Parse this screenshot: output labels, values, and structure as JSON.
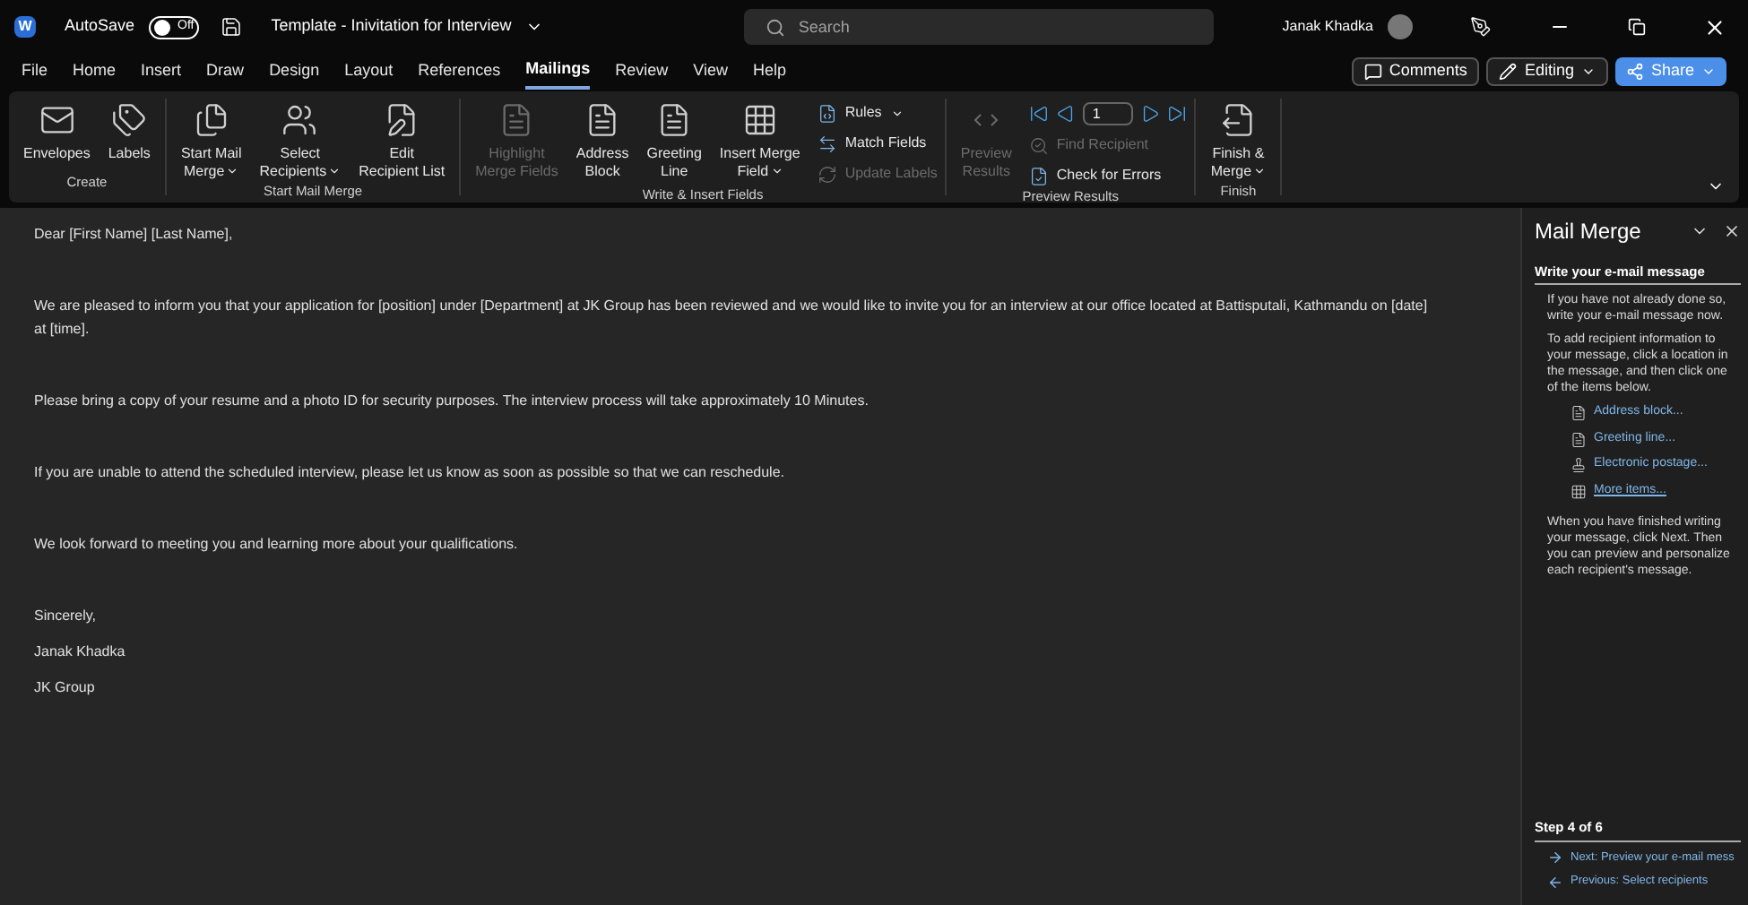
{
  "title_bar": {
    "logo_letter": "W",
    "autosave": {
      "label": "AutoSave",
      "on": false,
      "state_text": "Off"
    },
    "document_title": "Template - Inivitation for Interview",
    "search": {
      "placeholder": "Search"
    },
    "user_name": "Janak Khadka"
  },
  "menu_tabs": [
    {
      "label": "File",
      "selected": false
    },
    {
      "label": "Home",
      "selected": false
    },
    {
      "label": "Insert",
      "selected": false
    },
    {
      "label": "Draw",
      "selected": false
    },
    {
      "label": "Design",
      "selected": false
    },
    {
      "label": "Layout",
      "selected": false
    },
    {
      "label": "References",
      "selected": false
    },
    {
      "label": "Mailings",
      "selected": true
    },
    {
      "label": "Review",
      "selected": false
    },
    {
      "label": "View",
      "selected": false
    },
    {
      "label": "Help",
      "selected": false
    }
  ],
  "actions": [
    {
      "label": "Comments",
      "kind": "comments"
    },
    {
      "label": "Editing",
      "kind": "editing"
    },
    {
      "label": "Share",
      "kind": "share"
    }
  ],
  "ribbon_groups": [
    {
      "label": "Create",
      "items": [
        {
          "kind": "large",
          "label": "Envelopes",
          "disabled": false,
          "dropdown": false
        },
        {
          "kind": "large",
          "label": "Labels",
          "disabled": false,
          "dropdown": false
        }
      ]
    },
    {
      "label": "Start Mail Merge",
      "items": [
        {
          "kind": "large",
          "label": "Start Mail\nMerge",
          "disabled": false,
          "dropdown": true
        },
        {
          "kind": "large",
          "label": "Select\nRecipients",
          "disabled": false,
          "dropdown": true
        },
        {
          "kind": "large",
          "label": "Edit\nRecipient List",
          "disabled": false,
          "dropdown": false
        }
      ]
    },
    {
      "label": "Write & Insert Fields",
      "items": [
        {
          "kind": "large",
          "label": "Highlight\nMerge Fields",
          "disabled": true,
          "dropdown": false
        },
        {
          "kind": "large",
          "label": "Address\nBlock",
          "disabled": false,
          "dropdown": false
        },
        {
          "kind": "large",
          "label": "Greeting\nLine",
          "disabled": false,
          "dropdown": false
        },
        {
          "kind": "large",
          "label": "Insert Merge\nField",
          "disabled": false,
          "dropdown": true
        },
        {
          "kind": "small",
          "label": "Rules",
          "disabled": false,
          "dropdown": true
        },
        {
          "kind": "small",
          "label": "Match Fields",
          "disabled": false,
          "dropdown": false
        },
        {
          "kind": "small",
          "label": "Update Labels",
          "disabled": true,
          "dropdown": false
        }
      ]
    },
    {
      "label": "Preview Results",
      "items": [
        {
          "kind": "large",
          "label": "Preview\nResults",
          "disabled": true,
          "dropdown": false
        },
        {
          "kind": "nav",
          "record": "1"
        },
        {
          "kind": "small",
          "label": "Find Recipient",
          "disabled": true,
          "dropdown": false
        },
        {
          "kind": "small",
          "label": "Check for Errors",
          "disabled": false,
          "dropdown": false
        }
      ]
    },
    {
      "label": "Finish",
      "items": [
        {
          "kind": "large",
          "label": "Finish &\nMerge",
          "disabled": false,
          "dropdown": true
        }
      ]
    }
  ],
  "document": {
    "paragraphs": [
      "Dear [First Name] [Last Name],",
      "We are pleased to inform you that your application for [position] under [Department] at JK Group has been reviewed and we would like to invite you for an interview at our office located at Battisputali, Kathmandu on [date] at [time].",
      "Please bring a copy of your resume and a photo ID for security purposes. The interview process will take approximately 10 Minutes.",
      "If you are unable to attend the scheduled interview, please let us know as soon as possible so that we can reschedule.",
      "We look forward to meeting you and learning more about your qualifications."
    ],
    "closing": [
      "Sincerely,",
      "Janak Khadka",
      "JK Group"
    ]
  },
  "task_pane": {
    "title": "Mail Merge",
    "heading": "Write your e-mail message",
    "intro": [
      "If you have not already done so, write your e-mail message now.",
      "To add recipient information to your message, click a location in the message, and then click one of the items below."
    ],
    "links": [
      {
        "label": "Address block...",
        "selected": false
      },
      {
        "label": "Greeting line...",
        "selected": false
      },
      {
        "label": "Electronic postage...",
        "selected": false
      },
      {
        "label": "More items...",
        "selected": true
      }
    ],
    "outro": "When you have finished writing your message, click Next. Then you can preview and personalize each recipient's message.",
    "step": "Step 4 of 6",
    "next": "Next: Preview your e-mail mess",
    "previous": "Previous: Select recipients"
  }
}
